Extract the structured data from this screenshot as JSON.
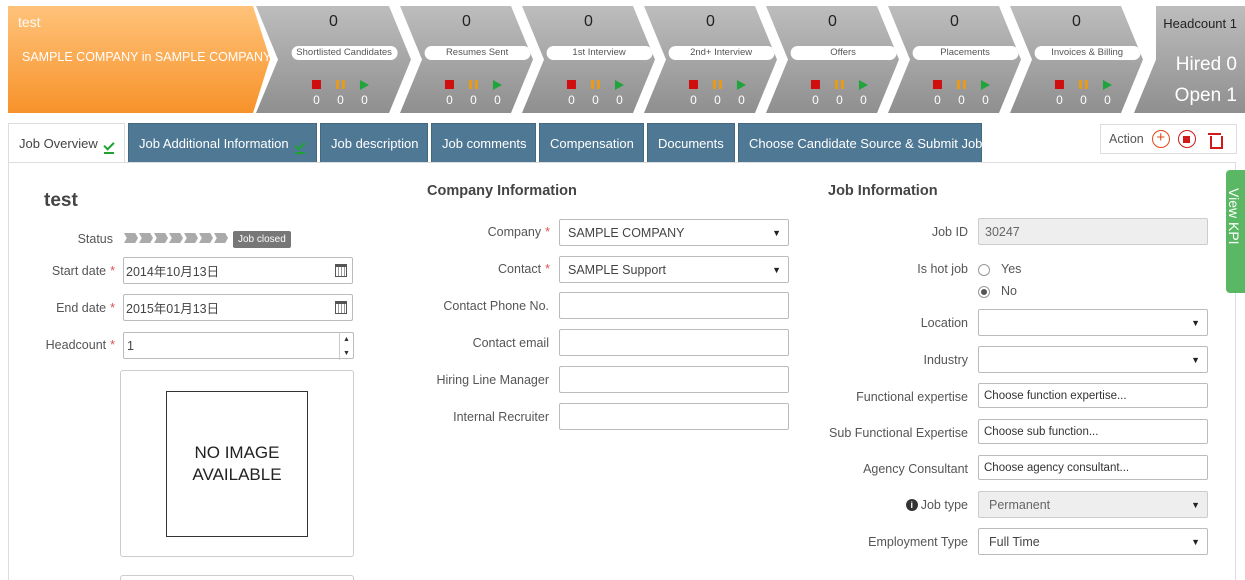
{
  "job": {
    "name": "test",
    "company_line": "SAMPLE COMPANY in SAMPLE COMPANY"
  },
  "pipeline": [
    {
      "count": "0",
      "label": "Shortlisted Candidates",
      "stopped": "0",
      "paused": "0",
      "active": "0"
    },
    {
      "count": "0",
      "label": "Resumes Sent",
      "stopped": "0",
      "paused": "0",
      "active": "0"
    },
    {
      "count": "0",
      "label": "1st Interview",
      "stopped": "0",
      "paused": "0",
      "active": "0"
    },
    {
      "count": "0",
      "label": "2nd+ Interview",
      "stopped": "0",
      "paused": "0",
      "active": "0"
    },
    {
      "count": "0",
      "label": "Offers",
      "stopped": "0",
      "paused": "0",
      "active": "0"
    },
    {
      "count": "0",
      "label": "Placements",
      "stopped": "0",
      "paused": "0",
      "active": "0"
    },
    {
      "count": "0",
      "label": "Invoices & Billing",
      "stopped": "0",
      "paused": "0",
      "active": "0"
    }
  ],
  "headcount": {
    "headcount_label": "Headcount 1",
    "hired_label": "Hired 0",
    "open_label": "Open 1"
  },
  "tabs": [
    "Job Overview",
    "Job Additional Information",
    "Job description",
    "Job comments",
    "Compensation",
    "Documents",
    "Choose Candidate Source & Submit Job"
  ],
  "action": {
    "label": "Action"
  },
  "overview": {
    "title": "test",
    "status_label": "Status",
    "status_badge": "Job closed",
    "start_label": "Start date",
    "start_value": "2014年10月13日",
    "end_label": "End date",
    "end_value": "2015年01月13日",
    "headcount_label": "Headcount",
    "headcount_value": "1",
    "no_image": "NO IMAGE AVAILABLE"
  },
  "company_info": {
    "title": "Company Information",
    "company_label": "Company",
    "company_value": "SAMPLE COMPANY",
    "contact_label": "Contact",
    "contact_value": "SAMPLE Support",
    "phone_label": "Contact Phone No.",
    "email_label": "Contact email",
    "hiring_label": "Hiring Line Manager",
    "recruiter_label": "Internal Recruiter"
  },
  "job_info": {
    "title": "Job Information",
    "job_id_label": "Job ID",
    "job_id_value": "30247",
    "hot_label": "Is hot job",
    "hot_yes": "Yes",
    "hot_no": "No",
    "location_label": "Location",
    "industry_label": "Industry",
    "functional_label": "Functional expertise",
    "functional_placeholder": "Choose function expertise...",
    "subfunctional_label": "Sub Functional Expertise",
    "subfunctional_placeholder": "Choose sub function...",
    "agency_label": "Agency Consultant",
    "agency_placeholder": "Choose agency consultant...",
    "jobtype_label": "Job type",
    "jobtype_value": "Permanent",
    "employment_label": "Employment Type",
    "employment_value": "Full Time"
  },
  "side_tab": {
    "label": "View KPI"
  },
  "colors": {
    "accent_orange": "#f7922a",
    "tab_blue": "#4f7895",
    "check_green": "#1ea232",
    "kpi_green": "#5ab865"
  }
}
